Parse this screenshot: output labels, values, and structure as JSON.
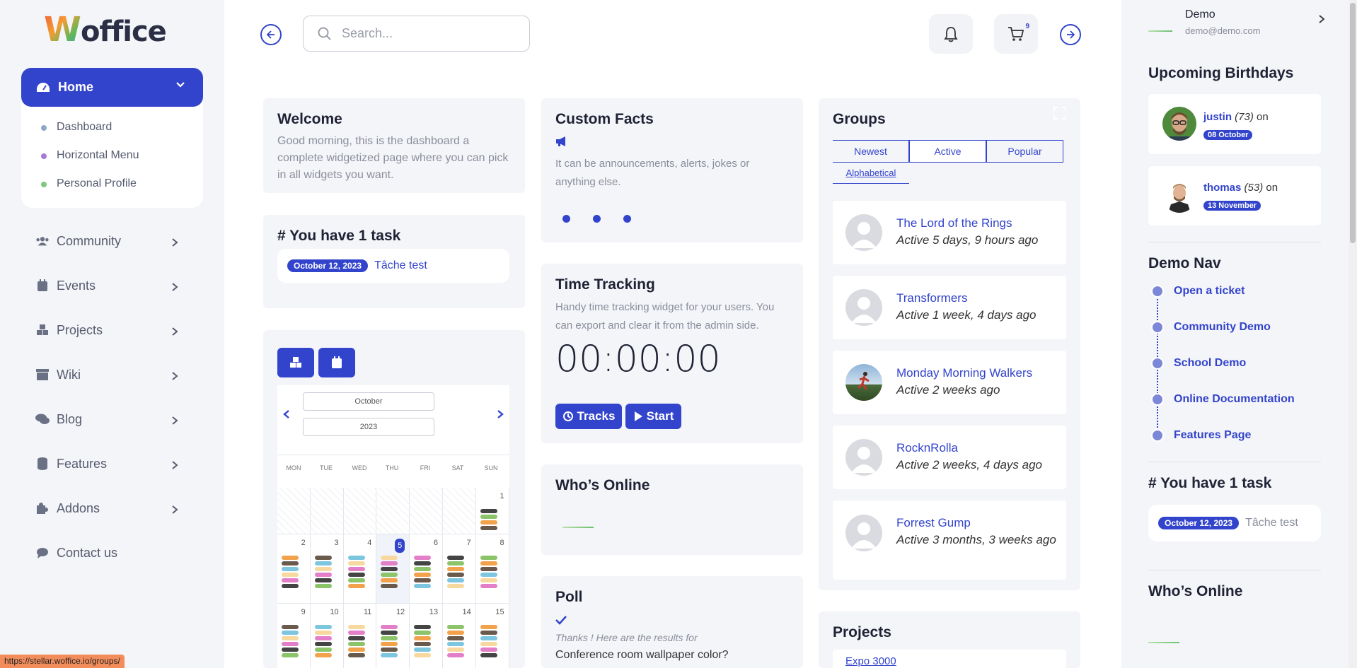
{
  "logo": {
    "first": "W",
    "rest": "office"
  },
  "sidebar": {
    "home_label": "Home",
    "sub_items": [
      {
        "label": "Dashboard",
        "color": "#8fa7c8"
      },
      {
        "label": "Horizontal Menu",
        "color": "#a77ad8"
      },
      {
        "label": "Personal Profile",
        "color": "#7fc77f"
      }
    ],
    "items": [
      {
        "label": "Community",
        "icon": "users-icon"
      },
      {
        "label": "Events",
        "icon": "calendar-icon"
      },
      {
        "label": "Projects",
        "icon": "cubes-icon"
      },
      {
        "label": "Wiki",
        "icon": "archive-icon"
      },
      {
        "label": "Blog",
        "icon": "comments-icon"
      },
      {
        "label": "Features",
        "icon": "database-icon"
      },
      {
        "label": "Addons",
        "icon": "puzzle-icon"
      },
      {
        "label": "Contact us",
        "icon": "chat-icon"
      }
    ]
  },
  "header": {
    "search_placeholder": "Search...",
    "cart_count": "9"
  },
  "welcome": {
    "title": "Welcome",
    "text": "Good morning, this is the dashboard a complete widgetized page where you can pick in all widgets you want."
  },
  "tasks": {
    "title": "# You have 1 task",
    "date": "October 12, 2023",
    "task": "Tâche test"
  },
  "calendar": {
    "month": "October",
    "year": "2023",
    "days": [
      "MON",
      "TUE",
      "WED",
      "THU",
      "FRI",
      "SAT",
      "SUN"
    ],
    "row1": [
      "",
      "",
      "",
      "",
      "",
      "",
      "1"
    ],
    "row2": [
      "2",
      "3",
      "4",
      "5",
      "6",
      "7",
      "8"
    ],
    "row3": [
      "9",
      "10",
      "11",
      "12",
      "13",
      "14",
      "15"
    ]
  },
  "custom_facts": {
    "title": "Custom Facts",
    "text": "It can be announcements, alerts, jokes or anything else."
  },
  "time_tracking": {
    "title": "Time Tracking",
    "text": "Handy time tracking widget for your users. You can export and clear it from the admin side.",
    "time": "00:00:00",
    "tracks_label": "Tracks",
    "start_label": "Start"
  },
  "whos_online": {
    "title": "Who’s Online"
  },
  "poll": {
    "title": "Poll",
    "thanks": "Thanks ! Here are the results for",
    "question": "Conference room wallpaper color?"
  },
  "groups": {
    "title": "Groups",
    "tabs": [
      "Newest",
      "Active",
      "Popular",
      "Alphabetical"
    ],
    "items": [
      {
        "name": "The Lord of the Rings",
        "activity": "Active 5 days, 9 hours ago"
      },
      {
        "name": "Transformers",
        "activity": "Active 1 week, 4 days ago"
      },
      {
        "name": "Monday Morning Walkers",
        "activity": "Active 2 weeks ago"
      },
      {
        "name": "RocknRolla",
        "activity": "Active 2 weeks, 4 days ago"
      },
      {
        "name": "Forrest Gump",
        "activity": "Active 3 months, 3 weeks ago"
      }
    ]
  },
  "projects": {
    "title": "Projects",
    "first": "Expo 3000"
  },
  "right": {
    "user_name": "Demo",
    "user_email": "demo@demo.com",
    "birthdays_title": "Upcoming Birthdays",
    "birthdays": [
      {
        "name": "justin",
        "age": "(73)",
        "on": "on",
        "date": "08 October"
      },
      {
        "name": "thomas",
        "age": "(53)",
        "on": "on",
        "date": "13 November"
      }
    ],
    "demo_nav_title": "Demo Nav",
    "demo_nav": [
      "Open a ticket",
      "Community Demo",
      "School Demo",
      "Online Documentation",
      "Features Page"
    ],
    "tasks_title": "# You have 1 task",
    "task_date": "October 12, 2023",
    "task_name": "Tâche test",
    "online_title": "Who’s Online"
  },
  "status_url": "https://stellar.woffice.io/groups/",
  "colors": {
    "accent": "#3344cc",
    "panel": "#f4f5f8"
  }
}
